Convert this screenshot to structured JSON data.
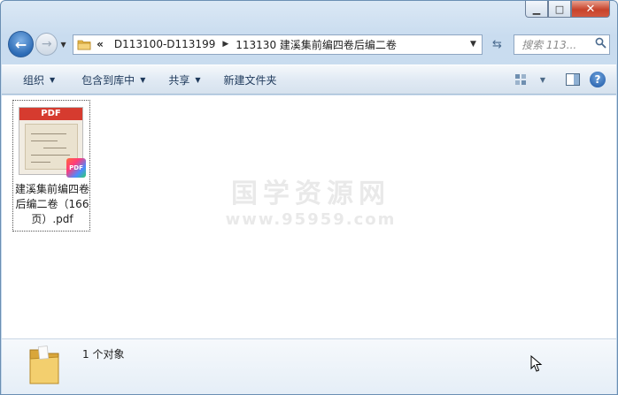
{
  "window": {
    "minimize_glyph": "▁",
    "maximize_glyph": "□",
    "close_glyph": "✕"
  },
  "nav": {
    "back_glyph": "←",
    "forward_glyph": "→",
    "breadcrumb": [
      {
        "label": "«"
      },
      {
        "label": "D113100-D113199"
      },
      {
        "label": "113130 建溪集前编四卷后编二卷"
      }
    ],
    "search_placeholder": "搜索 113..."
  },
  "toolbar": {
    "items": [
      {
        "label": "组织",
        "has_dropdown": true
      },
      {
        "label": "包含到库中",
        "has_dropdown": true
      },
      {
        "label": "共享",
        "has_dropdown": true
      },
      {
        "label": "新建文件夹",
        "has_dropdown": false
      }
    ],
    "help_glyph": "?"
  },
  "files": [
    {
      "name": "建溪集前编四卷后编二卷（166页）.pdf",
      "thumb_label": "PDF",
      "badge_label": "PDF"
    }
  ],
  "watermark": {
    "line1": "国学资源网",
    "line2": "www.95959.com"
  },
  "status": {
    "count_text": "1 个对象"
  },
  "colors": {
    "accent": "#1e395b",
    "pdf_red": "#d63b2f",
    "folder": "#e8b84a"
  }
}
